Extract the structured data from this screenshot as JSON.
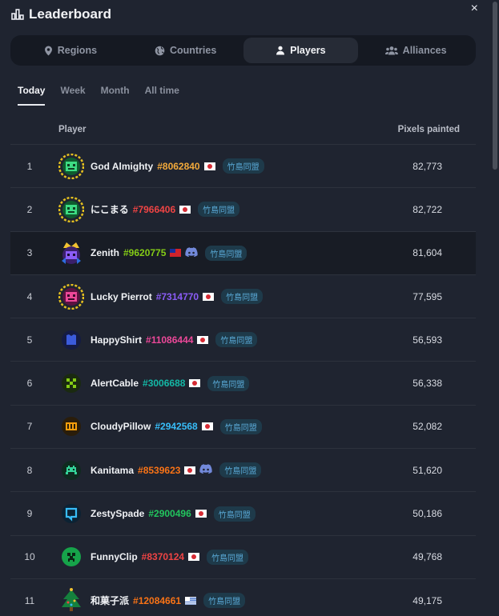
{
  "header": {
    "title": "Leaderboard",
    "close_label": "×"
  },
  "tabs": [
    {
      "label": "Regions",
      "icon": "map-pin-icon"
    },
    {
      "label": "Countries",
      "icon": "globe-icon"
    },
    {
      "label": "Players",
      "icon": "user-icon",
      "active": true
    },
    {
      "label": "Alliances",
      "icon": "users-icon"
    }
  ],
  "periods": [
    "Today",
    "Week",
    "Month",
    "All time"
  ],
  "active_period": "Today",
  "columns": {
    "player": "Player",
    "pixels": "Pixels painted"
  },
  "colors": {
    "background": "#1f2430",
    "id_orange": "#f2a93b",
    "id_red": "#ef4444",
    "id_green": "#84cc16",
    "id_purple": "#8b5cf6",
    "id_pink": "#ec4899",
    "id_teal": "#14b8a6",
    "id_cyan": "#38bdf8",
    "id_coral": "#f97316",
    "alliance_badge": "#59a9d6"
  },
  "players": [
    {
      "rank": "1",
      "name": "God Almighty",
      "id": "#8062840",
      "id_color": "#f2a93b",
      "flag": "jp",
      "alliance": "竹島同盟",
      "pixels": "82,773",
      "avatar": "green-pixel-face-avatar"
    },
    {
      "rank": "2",
      "name": "にこまる",
      "id": "#7966406",
      "id_color": "#ef4444",
      "flag": "jp",
      "alliance": "竹島同盟",
      "pixels": "82,722",
      "avatar": "green-pixel-face-avatar"
    },
    {
      "rank": "3",
      "name": "Zenith",
      "id": "#9620775",
      "id_color": "#84cc16",
      "flag": "tw",
      "discord": true,
      "alliance": "竹島同盟",
      "pixels": "81,604",
      "avatar": "purple-crown-avatar",
      "highlight": true
    },
    {
      "rank": "4",
      "name": "Lucky Pierrot",
      "id": "#7314770",
      "id_color": "#8b5cf6",
      "flag": "jp",
      "alliance": "竹島同盟",
      "pixels": "77,595",
      "avatar": "pink-pixel-face-avatar"
    },
    {
      "rank": "5",
      "name": "HappyShirt",
      "id": "#11086444",
      "id_color": "#ec4899",
      "flag": "jp",
      "alliance": "竹島同盟",
      "pixels": "56,593",
      "avatar": "blue-shirt-avatar"
    },
    {
      "rank": "6",
      "name": "AlertCable",
      "id": "#3006688",
      "id_color": "#14b8a6",
      "flag": "jp",
      "alliance": "竹島同盟",
      "pixels": "56,338",
      "avatar": "green-cable-avatar"
    },
    {
      "rank": "7",
      "name": "CloudyPillow",
      "id": "#2942568",
      "id_color": "#38bdf8",
      "flag": "jp",
      "alliance": "竹島同盟",
      "pixels": "52,082",
      "avatar": "orange-pillow-avatar"
    },
    {
      "rank": "8",
      "name": "Kanitama",
      "id": "#8539623",
      "id_color": "#f97316",
      "flag": "jp",
      "discord": true,
      "alliance": "竹島同盟",
      "pixels": "51,620",
      "avatar": "green-invader-avatar"
    },
    {
      "rank": "9",
      "name": "ZestySpade",
      "id": "#2900496",
      "id_color": "#22c55e",
      "flag": "jp",
      "alliance": "竹島同盟",
      "pixels": "50,186",
      "avatar": "cyan-spade-avatar"
    },
    {
      "rank": "10",
      "name": "FunnyClip",
      "id": "#8370124",
      "id_color": "#ef4444",
      "flag": "jp",
      "alliance": "竹島同盟",
      "pixels": "49,768",
      "avatar": "green-creeper-avatar"
    },
    {
      "rank": "11",
      "name": "和菓子派",
      "id": "#12084661",
      "id_color": "#f97316",
      "flag": "uy",
      "alliance": "竹島同盟",
      "pixels": "49,175",
      "avatar": "christmas-tree-avatar"
    }
  ]
}
